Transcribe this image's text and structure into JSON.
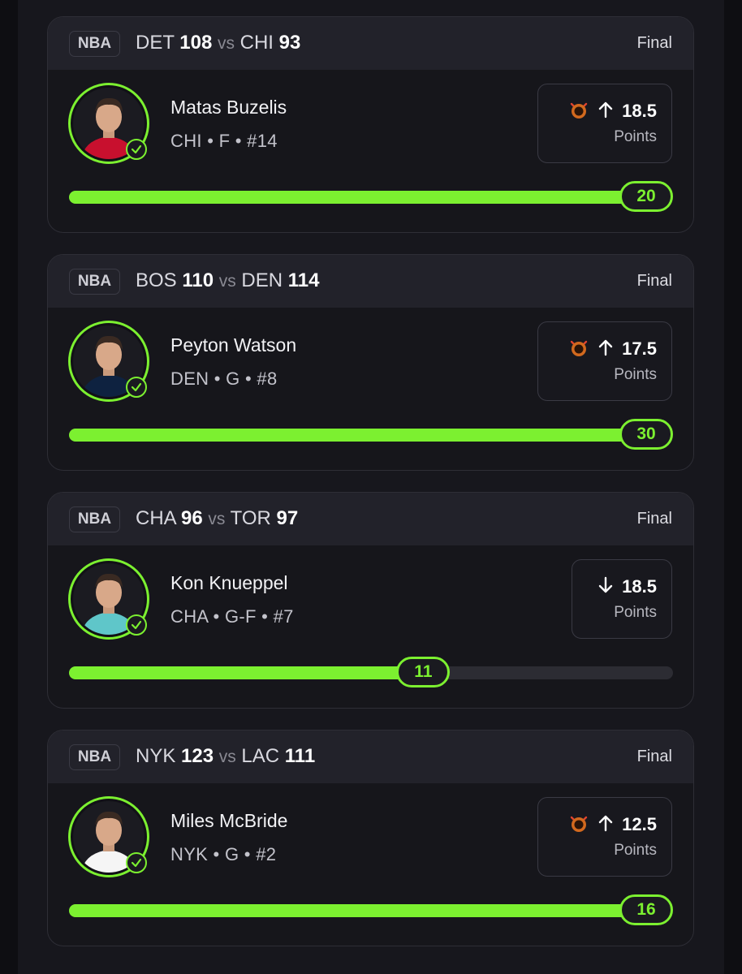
{
  "cards": [
    {
      "league": "NBA",
      "team1": "DET",
      "score1": "108",
      "vs": "vs",
      "team2": "CHI",
      "score2": "93",
      "status": "Final",
      "player_name": "Matas Buzelis",
      "player_meta": "CHI • F • #14",
      "direction": "over",
      "has_demon": true,
      "line_value": "18.5",
      "line_label": "Points",
      "result": "20",
      "progress": 1.0,
      "jersey_color": "#c8102e",
      "avatar_icon": "player-headshot-icon"
    },
    {
      "league": "NBA",
      "team1": "BOS",
      "score1": "110",
      "vs": "vs",
      "team2": "DEN",
      "score2": "114",
      "status": "Final",
      "player_name": "Peyton Watson",
      "player_meta": "DEN • G • #8",
      "direction": "over",
      "has_demon": true,
      "line_value": "17.5",
      "line_label": "Points",
      "result": "30",
      "progress": 1.0,
      "jersey_color": "#0e2240",
      "avatar_icon": "player-headshot-icon"
    },
    {
      "league": "NBA",
      "team1": "CHA",
      "score1": "96",
      "vs": "vs",
      "team2": "TOR",
      "score2": "97",
      "status": "Final",
      "player_name": "Kon Knueppel",
      "player_meta": "CHA • G-F • #7",
      "direction": "under",
      "has_demon": false,
      "line_value": "18.5",
      "line_label": "Points",
      "result": "11",
      "progress": 0.595,
      "jersey_color": "#5fc6c9",
      "avatar_icon": "player-headshot-icon"
    },
    {
      "league": "NBA",
      "team1": "NYK",
      "score1": "123",
      "vs": "vs",
      "team2": "LAC",
      "score2": "111",
      "status": "Final",
      "player_name": "Miles McBride",
      "player_meta": "NYK • G • #2",
      "direction": "over",
      "has_demon": true,
      "line_value": "12.5",
      "line_label": "Points",
      "result": "16",
      "progress": 1.0,
      "jersey_color": "#f5f5f5",
      "avatar_icon": "player-headshot-icon"
    }
  ],
  "colors": {
    "accent": "#7cf030",
    "background": "#16161b",
    "header": "#22222a",
    "track": "#2c2c33",
    "demon": "#d2691e"
  }
}
